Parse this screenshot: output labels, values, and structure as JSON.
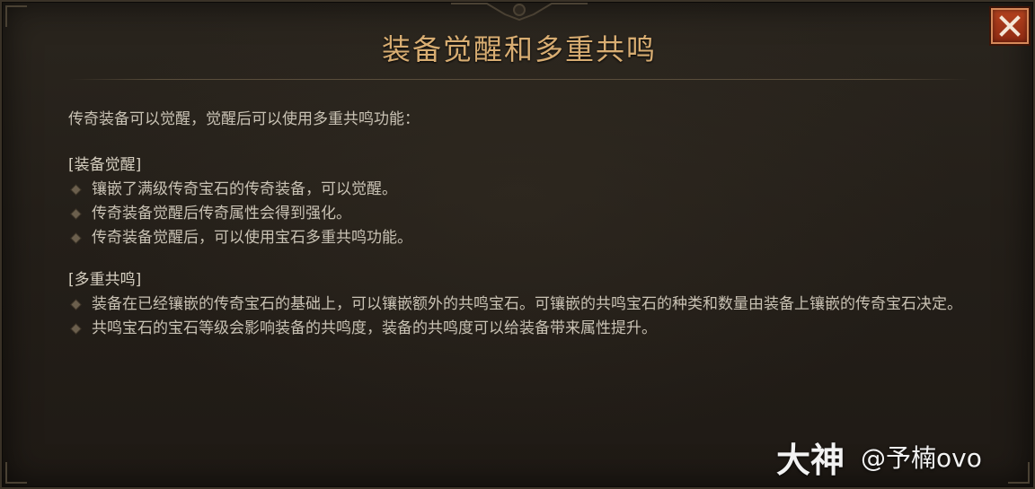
{
  "dialog": {
    "title": "装备觉醒和多重共鸣",
    "close_icon": "close-x-icon",
    "intro": "传奇装备可以觉醒，觉醒后可以使用多重共鸣功能：",
    "sections": [
      {
        "heading": "[装备觉醒]",
        "items": [
          "镶嵌了满级传奇宝石的传奇装备，可以觉醒。",
          "传奇装备觉醒后传奇属性会得到强化。",
          "传奇装备觉醒后，可以使用宝石多重共鸣功能。"
        ]
      },
      {
        "heading": "[多重共鸣]",
        "items": [
          "装备在已经镶嵌的传奇宝石的基础上，可以镶嵌额外的共鸣宝石。可镶嵌的共鸣宝石的种类和数量由装备上镶嵌的传奇宝石决定。",
          "共鸣宝石的宝石等级会影响装备的共鸣度，装备的共鸣度可以给装备带来属性提升。"
        ]
      }
    ]
  },
  "watermark": {
    "brand": "大神",
    "user": "@予楠ovo"
  },
  "colors": {
    "title": "#d8ad72",
    "body_text": "#c9c2b4",
    "close_button": "#a3381a",
    "panel": "#241f19"
  }
}
